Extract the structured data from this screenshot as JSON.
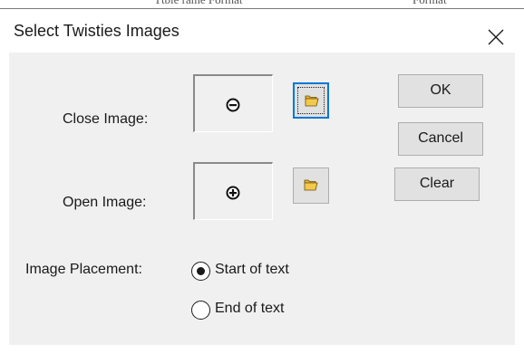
{
  "background_window": {
    "text_fragment_1": "Ttble rame Format",
    "text_fragment_2": "Format"
  },
  "dialog": {
    "title": "Select Twisties Images",
    "close_glyph": "✕",
    "close_image_label": "Close Image:",
    "open_image_label": "Open Image:",
    "close_image_icon": "circle-minus-icon",
    "open_image_icon": "circle-plus-icon",
    "browse_icon": "open-folder-icon",
    "buttons": {
      "ok": "OK",
      "cancel": "Cancel",
      "clear": "Clear"
    },
    "placement": {
      "label": "Image Placement:",
      "options": [
        "Start of text",
        "End of text"
      ],
      "selected": "Start of text"
    }
  },
  "colors": {
    "dialog_bg": "#f0f0f0",
    "button_bg": "#e1e1e1",
    "focus": "#0078d7",
    "folder_yellow": "#f2c94c"
  }
}
